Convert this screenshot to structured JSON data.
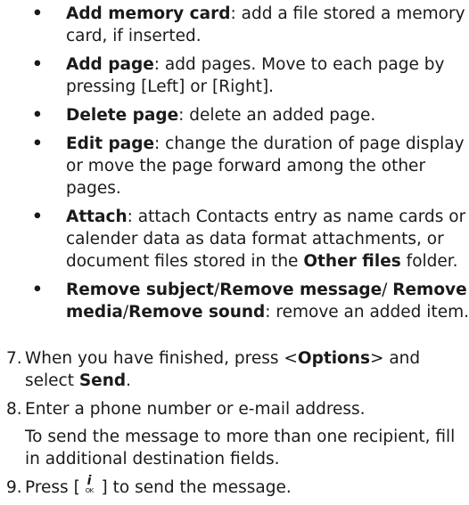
{
  "bullets": [
    {
      "segments": [
        {
          "t": "Add memory card",
          "b": true
        },
        {
          "t": ": add a file stored a memory card, if inserted.",
          "b": false
        }
      ]
    },
    {
      "segments": [
        {
          "t": "Add page",
          "b": true
        },
        {
          "t": ": add pages. Move to each page by pressing [Left] or [Right].",
          "b": false
        }
      ]
    },
    {
      "segments": [
        {
          "t": "Delete page",
          "b": true
        },
        {
          "t": ": delete an added page.",
          "b": false
        }
      ]
    },
    {
      "segments": [
        {
          "t": "Edit page",
          "b": true
        },
        {
          "t": ": change the duration of page display or move the page forward among the other pages.",
          "b": false
        }
      ]
    },
    {
      "segments": [
        {
          "t": "Attach",
          "b": true
        },
        {
          "t": ": attach Contacts entry as name cards or calender data as data format attachments, or document files stored in the ",
          "b": false
        },
        {
          "t": "Other files",
          "b": true
        },
        {
          "t": " folder.",
          "b": false
        }
      ]
    },
    {
      "segments": [
        {
          "t": "Remove subject",
          "b": true
        },
        {
          "t": "/",
          "b": false
        },
        {
          "t": "Remove message",
          "b": true
        },
        {
          "t": "/ ",
          "b": false
        },
        {
          "t": "Remove media",
          "b": true
        },
        {
          "t": "/",
          "b": false
        },
        {
          "t": "Remove sound",
          "b": true
        },
        {
          "t": ": remove an added item.",
          "b": false
        }
      ]
    }
  ],
  "steps": [
    {
      "num": "7.",
      "segments": [
        {
          "t": "When you have finished, press <",
          "b": false
        },
        {
          "t": "Options",
          "b": true
        },
        {
          "t": "> and select ",
          "b": false
        },
        {
          "t": "Send",
          "b": true
        },
        {
          "t": ".",
          "b": false
        }
      ],
      "sub": ""
    },
    {
      "num": "8.",
      "segments": [
        {
          "t": "Enter a phone number or e-mail address.",
          "b": false
        }
      ],
      "sub": "To send the message to more than one recipient, fill in additional destination fields."
    },
    {
      "num": "9.",
      "segments": [
        {
          "t": "Press [ ",
          "b": false
        },
        {
          "icon": "ok-key"
        },
        {
          "t": " ] to send the message.",
          "b": false
        }
      ],
      "sub": ""
    }
  ],
  "icons": {
    "ok_key_glyph": "i",
    "ok_key_label": "OK"
  }
}
